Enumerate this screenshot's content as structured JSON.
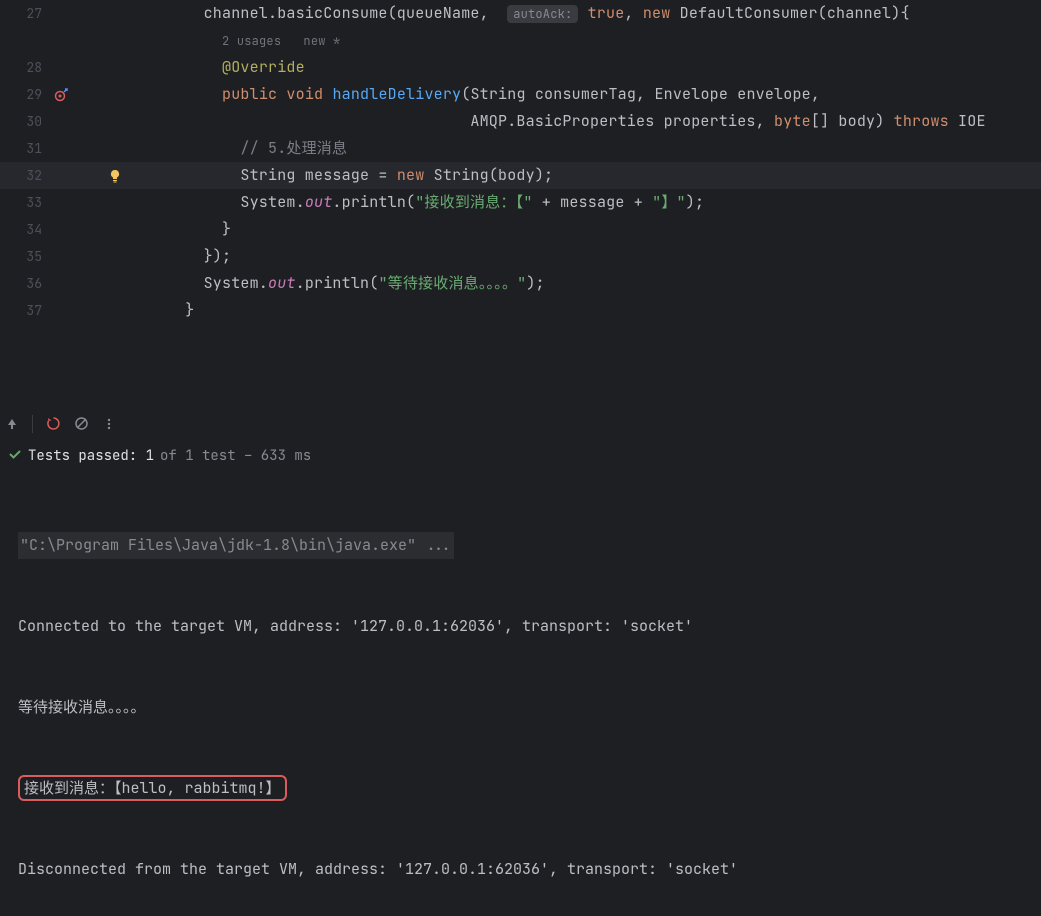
{
  "editor": {
    "lines": [
      {
        "num": "27",
        "content": [
          {
            "t": "plain",
            "v": "        channel.basicConsume(queueName,  "
          },
          {
            "t": "hint",
            "v": "autoAck:"
          },
          {
            "t": "plain",
            "v": " "
          },
          {
            "t": "kw-orange",
            "v": "true"
          },
          {
            "t": "plain",
            "v": ", "
          },
          {
            "t": "kw-orange",
            "v": "new"
          },
          {
            "t": "plain",
            "v": " DefaultConsumer(channel){"
          }
        ]
      },
      {
        "num": "",
        "content": [
          {
            "t": "plain",
            "v": "          "
          },
          {
            "t": "usage",
            "v": "2 usages   new *"
          }
        ]
      },
      {
        "num": "28",
        "content": [
          {
            "t": "plain",
            "v": "          "
          },
          {
            "t": "annotation",
            "v": "@Override"
          }
        ]
      },
      {
        "num": "29",
        "icon": "target",
        "content": [
          {
            "t": "plain",
            "v": "          "
          },
          {
            "t": "kw-orange",
            "v": "public"
          },
          {
            "t": "plain",
            "v": " "
          },
          {
            "t": "kw-orange",
            "v": "void"
          },
          {
            "t": "plain",
            "v": " "
          },
          {
            "t": "method-def",
            "v": "handleDelivery"
          },
          {
            "t": "plain",
            "v": "(String consumerTag, Envelope envelope,"
          }
        ]
      },
      {
        "num": "30",
        "content": [
          {
            "t": "plain",
            "v": "                                     AMQP.BasicProperties properties, "
          },
          {
            "t": "kw-orange",
            "v": "byte"
          },
          {
            "t": "plain",
            "v": "[] body) "
          },
          {
            "t": "kw-orange",
            "v": "throws"
          },
          {
            "t": "plain",
            "v": " IOE"
          }
        ]
      },
      {
        "num": "31",
        "content": [
          {
            "t": "plain",
            "v": "            "
          },
          {
            "t": "comment",
            "v": "// 5.处理消息"
          }
        ]
      },
      {
        "num": "32",
        "icon": "bulb",
        "highlight": true,
        "content": [
          {
            "t": "plain",
            "v": "            String message = "
          },
          {
            "t": "kw-orange",
            "v": "new"
          },
          {
            "t": "plain",
            "v": " String(body);"
          }
        ]
      },
      {
        "num": "33",
        "content": [
          {
            "t": "plain",
            "v": "            System."
          },
          {
            "t": "field-purple",
            "v": "out"
          },
          {
            "t": "plain",
            "v": ".println("
          },
          {
            "t": "str-green",
            "v": "\"接收到消息：【\""
          },
          {
            "t": "plain",
            "v": " + message + "
          },
          {
            "t": "str-green",
            "v": "\"】\""
          },
          {
            "t": "plain",
            "v": ");"
          }
        ]
      },
      {
        "num": "34",
        "content": [
          {
            "t": "plain",
            "v": "          }"
          }
        ]
      },
      {
        "num": "35",
        "content": [
          {
            "t": "plain",
            "v": "        });"
          }
        ]
      },
      {
        "num": "36",
        "content": [
          {
            "t": "plain",
            "v": "        System."
          },
          {
            "t": "field-purple",
            "v": "out"
          },
          {
            "t": "plain",
            "v": ".println("
          },
          {
            "t": "str-green",
            "v": "\"等待接收消息。。。。\""
          },
          {
            "t": "plain",
            "v": ");"
          }
        ]
      },
      {
        "num": "37",
        "content": [
          {
            "t": "plain",
            "v": "      }"
          }
        ]
      }
    ]
  },
  "test_status": {
    "main": "Tests passed: 1",
    "sub": " of 1 test – 633 ms"
  },
  "console": {
    "cmd": "\"C:\\Program Files\\Java\\jdk-1.8\\bin\\java.exe\" ...",
    "line1": "Connected to the target VM, address: '127.0.0.1:62036', transport: 'socket'",
    "line2": "等待接收消息。。。。",
    "line3": "接收到消息：【hello, rabbitmq!】",
    "line4": "Disconnected from the target VM, address: '127.0.0.1:62036', transport: 'socket'"
  }
}
